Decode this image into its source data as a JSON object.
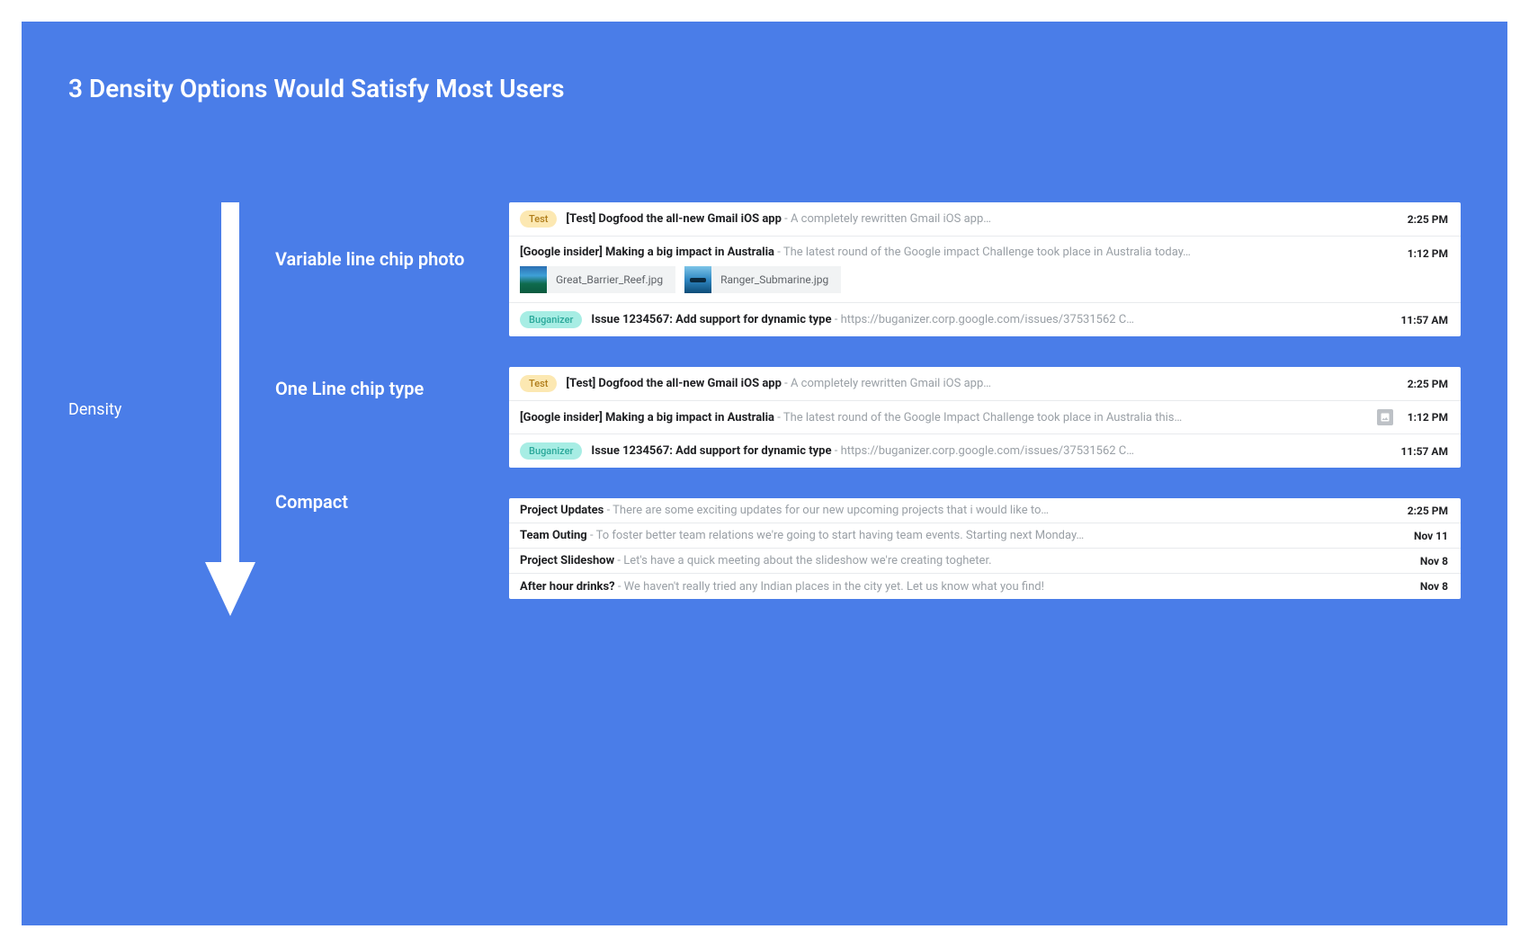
{
  "title": "3 Density Options Would Satisfy Most Users",
  "axisLabel": "Density",
  "sections": {
    "variable": {
      "label": "Variable line chip photo"
    },
    "oneline": {
      "label": "One Line chip type"
    },
    "compact": {
      "label": "Compact"
    }
  },
  "chips": {
    "test": "Test",
    "bug": "Buganizer"
  },
  "variableList": [
    {
      "chip": "test",
      "subject": "[Test] Dogfood the all-new Gmail iOS app",
      "preview": "A completely rewritten Gmail iOS app…",
      "time": "2:25 PM"
    },
    {
      "subject": "[Google insider] Making a big impact in Australia",
      "preview": "The latest round of the Google impact Challenge took place in Australia today…",
      "time": "1:12 PM",
      "attachments": [
        {
          "name": "Great_Barrier_Reef.jpg",
          "thumb": "reef"
        },
        {
          "name": "Ranger_Submarine.jpg",
          "thumb": "sub"
        }
      ]
    },
    {
      "chip": "bug",
      "subject": "Issue 1234567: Add support for dynamic type",
      "preview": "https://buganizer.corp.google.com/issues/37531562 C…",
      "time": "11:57 AM"
    }
  ],
  "onelineList": [
    {
      "chip": "test",
      "subject": "[Test] Dogfood the all-new Gmail iOS app",
      "preview": "A completely rewritten Gmail iOS app…",
      "time": "2:25 PM"
    },
    {
      "subject": "[Google insider] Making a big impact in Australia",
      "preview": "The latest round of the Google Impact Challenge took place in Australia this…",
      "time": "1:12 PM",
      "hasAttachmentIcon": true
    },
    {
      "chip": "bug",
      "subject": "Issue 1234567: Add support for dynamic type",
      "preview": "https://buganizer.corp.google.com/issues/37531562 C…",
      "time": "11:57 AM"
    }
  ],
  "compactList": [
    {
      "subject": "Project Updates",
      "preview": "There are some exciting updates for our new upcoming projects that i would like to…",
      "time": "2:25 PM"
    },
    {
      "subject": "Team Outing",
      "preview": "To foster better team relations we're going to start having team events. Starting next Monday…",
      "time": "Nov 11"
    },
    {
      "subject": "Project Slideshow",
      "preview": "Let's have a quick meeting about the slideshow we're creating togheter.",
      "time": "Nov 8"
    },
    {
      "subject": "After hour drinks?",
      "preview": "We haven't really tried any Indian places in the city yet. Let us know what you find!",
      "time": "Nov 8"
    }
  ]
}
